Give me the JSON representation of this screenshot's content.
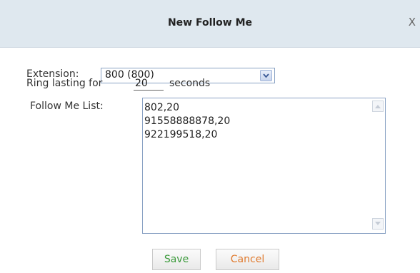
{
  "dialog": {
    "title": "New Follow Me",
    "close_label": "X"
  },
  "form": {
    "extension_label": "Extension:",
    "extension_value": "800 (800)",
    "ring_label": "Ring lasting for",
    "ring_value": "20",
    "ring_unit": "seconds",
    "list_label": "Follow Me List:",
    "list_items": [
      "802,20",
      "91558888878,20",
      "922199518,20"
    ]
  },
  "buttons": {
    "save_label": "Save",
    "cancel_label": "Cancel"
  },
  "colors": {
    "titlebar_bg": "#dfe8ef",
    "save_text": "#3a9a3a",
    "cancel_text": "#e07a2e",
    "field_border": "#8aa2c4"
  }
}
